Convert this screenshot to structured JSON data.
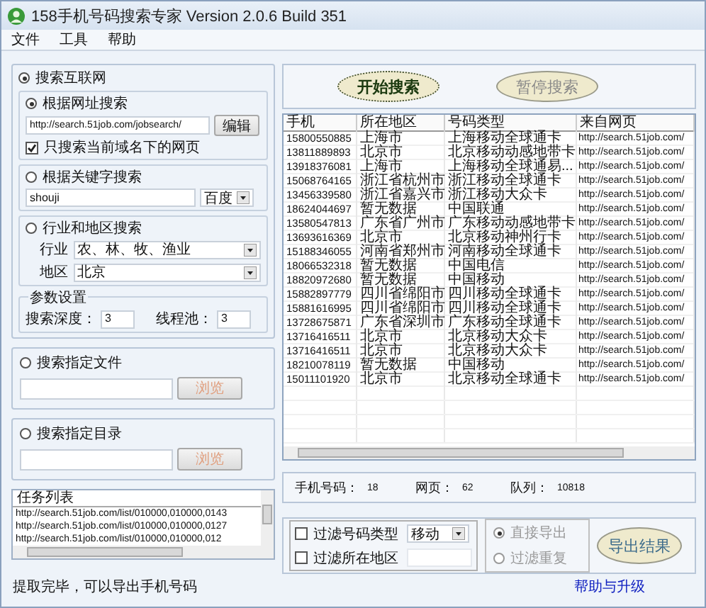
{
  "window": {
    "title": "158手机号码搜索专家 Version 2.0.6 Build 351"
  },
  "menu": [
    "文件",
    "工具",
    "帮助"
  ],
  "search_internet": {
    "label": "搜索互联网",
    "selected": true,
    "by_url": {
      "label": "根据网址搜索",
      "selected": true,
      "url": "http://search.51job.com/jobsearch/",
      "button": "编辑",
      "domain_only": {
        "label": "只搜索当前域名下的网页",
        "checked": true
      }
    },
    "by_keyword": {
      "label": "根据关键字搜索",
      "selected": false,
      "keyword": "shouji",
      "engine": "百度"
    },
    "by_region": {
      "label": "行业和地区搜索",
      "selected": false,
      "industry_label": "行业",
      "industry": "农、林、牧、渔业",
      "region_label": "地区",
      "region": "北京"
    },
    "params": {
      "title": "参数设置",
      "depth_label": "搜索深度：",
      "depth": "3",
      "threads_label": "线程池：",
      "threads": "3"
    }
  },
  "search_file": {
    "label": "搜索指定文件",
    "selected": false,
    "button": "浏览",
    "disabled": true
  },
  "search_dir": {
    "label": "搜索指定目录",
    "selected": false,
    "button": "浏览",
    "disabled": true
  },
  "task_list": {
    "title": "任务列表",
    "items": [
      "http://search.51job.com/list/010000,010000,0143",
      "http://search.51job.com/list/010000,010000,0127",
      "http://search.51job.com/list/010000,010000,012"
    ]
  },
  "status": "提取完毕，可以导出手机号码",
  "buttons": [
    {
      "label": "开始搜索",
      "disabled": false
    },
    {
      "label": "暂停搜索",
      "disabled": true
    }
  ],
  "table": {
    "columns": [
      "手机",
      "所在地区",
      "号码类型",
      "来自网页"
    ],
    "rows": [
      [
        "15800550885",
        "上海市",
        "上海移动全球通卡",
        "http://search.51job.com/"
      ],
      [
        "13811889893",
        "北京市",
        "北京移动动感地带卡",
        "http://search.51job.com/"
      ],
      [
        "13918376081",
        "上海市",
        "上海移动全球通易...",
        "http://search.51job.com/"
      ],
      [
        "15068764165",
        "浙江省杭州市",
        "浙江移动全球通卡",
        "http://search.51job.com/"
      ],
      [
        "13456339580",
        "浙江省嘉兴市",
        "浙江移动大众卡",
        "http://search.51job.com/"
      ],
      [
        "18624044697",
        "暂无数据",
        "中国联通",
        "http://search.51job.com/"
      ],
      [
        "13580547813",
        "广东省广州市",
        "广东移动动感地带卡",
        "http://search.51job.com/"
      ],
      [
        "13693616369",
        "北京市",
        "北京移动神州行卡",
        "http://search.51job.com/"
      ],
      [
        "15188346055",
        "河南省郑州市",
        "河南移动全球通卡",
        "http://search.51job.com/"
      ],
      [
        "18066532318",
        "暂无数据",
        "中国电信",
        "http://search.51job.com/"
      ],
      [
        "18820972680",
        "暂无数据",
        "中国移动",
        "http://search.51job.com/"
      ],
      [
        "15882897779",
        "四川省绵阳市",
        "四川移动全球通卡",
        "http://search.51job.com/"
      ],
      [
        "15881616995",
        "四川省绵阳市",
        "四川移动全球通卡",
        "http://search.51job.com/"
      ],
      [
        "13728675871",
        "广东省深圳市",
        "广东移动全球通卡",
        "http://search.51job.com/"
      ],
      [
        "13716416511",
        "北京市",
        "北京移动大众卡",
        "http://search.51job.com/"
      ],
      [
        "13716416511",
        "北京市",
        "北京移动大众卡",
        "http://search.51job.com/"
      ],
      [
        "18210078119",
        "暂无数据",
        "中国移动",
        "http://search.51job.com/"
      ],
      [
        "15011101920",
        "北京市",
        "北京移动全球通卡",
        "http://search.51job.com/"
      ]
    ]
  },
  "stats": [
    {
      "label": "手机号码：",
      "value": "18"
    },
    {
      "label": "网页：",
      "value": "62"
    },
    {
      "label": "队列：",
      "value": "10818"
    }
  ],
  "filters": [
    {
      "kind": "select",
      "label": "过滤号码类型",
      "checked": false,
      "value": "移动"
    },
    {
      "kind": "input",
      "label": "过滤所在地区",
      "checked": false
    }
  ],
  "export_options": [
    {
      "label": "直接导出",
      "selected": true,
      "disabled": true
    },
    {
      "label": "过滤重复",
      "selected": false,
      "disabled": true
    }
  ],
  "export_button": "导出结果",
  "help_link": "帮助与升级"
}
